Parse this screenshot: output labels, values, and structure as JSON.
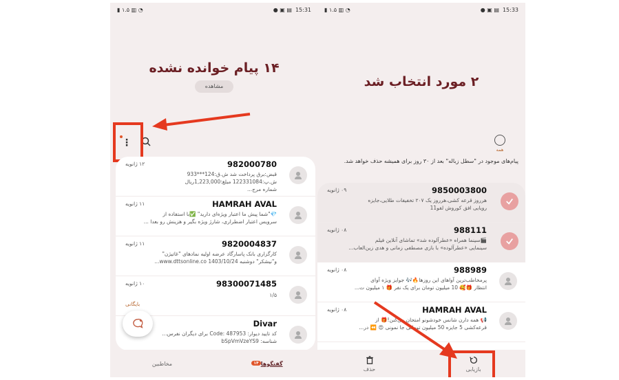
{
  "left_screen": {
    "status_left": [
      "15:31"
    ],
    "title": "۱۴ پیام خوانده نشده",
    "view_label": "مشاهده",
    "messages": [
      {
        "sender": "982000780",
        "date": "۱۲ ژانویه",
        "lines": [
          "قبض:برق پرداخت شد ش.ق:124***933",
          "ش.پ:122331084 مبلغ:1,223,000ریال",
          "شماره مرج..."
        ]
      },
      {
        "sender": "HAMRAH AVAL",
        "date": "۱۱ ژانویه",
        "lines": [
          "💎\"شما پیش ما اعتبار ویژه‌ای دارید\" ✅با استفاده از",
          "سرویس اعتبار اضطراری، شارژ ویژه بگیر و هزینش رو بعدا ..."
        ]
      },
      {
        "sender": "9820004837",
        "date": "۱۱ ژانویه",
        "lines": [
          "کارگزاری بانک پاسارگاد عرضه اولیه نمادهای \"غاتیژن\"",
          "و\"نیشکر\" دوشنبه 1403/10/24 www.dttsonline.co..."
        ]
      },
      {
        "sender": "98300071485",
        "date": "۱۰ ژانویه",
        "lines": [
          "۱/۵"
        ],
        "badge": "بایگانی"
      },
      {
        "sender": "Divar",
        "date": "",
        "lines": [
          "کد تایید دیوار: Code: 487953 برای دیگران نفرس...",
          "شناسه: bSpVmVzeYS9"
        ]
      }
    ],
    "nav": {
      "contacts": "مخاطبین",
      "conversations": "گفتگوها",
      "conversations_count": "۱۴"
    }
  },
  "right_screen": {
    "status_left": [
      "15:33"
    ],
    "title": "۲ مورد انتخاب شد",
    "all_label": "همه",
    "info_text": "پیام‌های موجود در \"سطل زباله\" بعد از ۳۰ روز برای همیشه حذف خواهد شد.",
    "messages": [
      {
        "sender": "9850003800",
        "date": "۰۹ ژانویه",
        "lines": [
          "هرروز قرعه کشی،هرروز یک ۲۰۷ تخفیفات طلایی،جایزه",
          "رویایی افق کوروش لفو11"
        ],
        "selected": true
      },
      {
        "sender": "988111",
        "date": "۰۸ ژانویه",
        "lines": [
          "🎬سینما همراه «عطرآلوده شد» تماشای آنلاین فیلم",
          "سینمایی «عطرآلوده» با بازی مصطفی زمانی و هدی زین‌العاب..."
        ],
        "selected": true
      },
      {
        "sender": "988989",
        "date": "۰۸ ژانویه",
        "lines": [
          "پرمخاطب‌ترین آواهای این روزها🔥🎶 جوایز ویژه آوای",
          "انتظار 🎁🥰 10 میلیون تومان برای یک نفر 🎁 ۱ میلیون ت..."
        ],
        "selected": false
      },
      {
        "sender": "HAMRAH AVAL",
        "date": "۰۸ ژانویه",
        "lines": [
          "📢 همه دارن شانس خودشونو امتحان می‌کنن!🎁 از",
          "قرعه‌کشی 5 جایزه 50 میلیون تومانی جا نمونی 😍 ⏪ در..."
        ],
        "selected": false
      }
    ],
    "nav": {
      "delete": "حذف",
      "restore": "بازیابی"
    }
  },
  "colors": {
    "accent": "#e5391f",
    "title": "#6b1f24",
    "check": "#e8a1a1"
  }
}
